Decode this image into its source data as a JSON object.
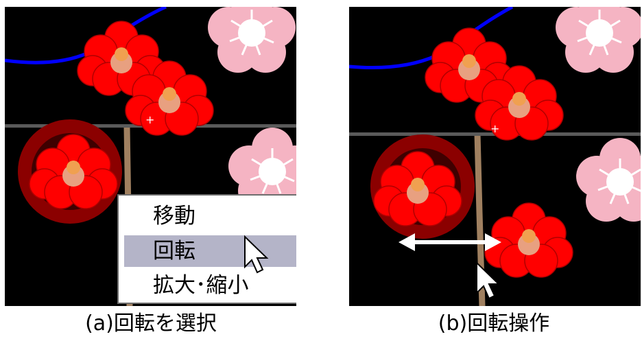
{
  "panel_a": {
    "context_menu": {
      "items": [
        {
          "label": "移動"
        },
        {
          "label": "回転",
          "selected": true
        },
        {
          "label": "拡大･縮小"
        }
      ]
    },
    "caption": "(a)回転を選択"
  },
  "panel_b": {
    "caption": "(b)回転操作"
  },
  "colors": {
    "canvas_background": "#000000",
    "curve_blue": "#0000ff",
    "guide_line": "#5a5a5a",
    "flower_red": "#ff0000",
    "flower_pink": "#f5b4c3",
    "rotation_ring": "#8b0000",
    "menu_highlight": "#b4b4c8",
    "rotate_arrow": "#ffffff"
  },
  "icons": [
    "mouse-cursor-icon",
    "rotate-handle-icon",
    "double-arrow-icon"
  ]
}
